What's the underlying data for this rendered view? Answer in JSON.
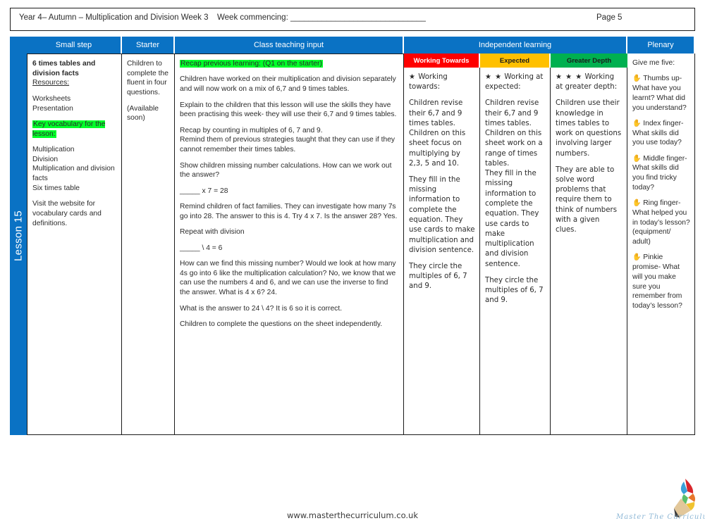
{
  "header": {
    "title": "Year 4– Autumn – Multiplication and Division Week 3",
    "week_commencing": "Week commencing: ______________________________",
    "page": "Page 5"
  },
  "lesson_tab": {
    "label": "Lesson 15"
  },
  "columns": {
    "small_step": "Small step",
    "starter": "Starter",
    "class_teaching_input": "Class teaching input",
    "independent_learning": "Independent learning",
    "plenary": "Plenary"
  },
  "bands": {
    "working_towards": "Working Towards",
    "expected": "Expected",
    "greater_depth": "Greater Depth"
  },
  "small_step": {
    "title": "6 times tables and division facts",
    "resources_label": "Resources:",
    "resource_1": "Worksheets",
    "resource_2": "Presentation",
    "key_vocab_label": "Key vocabulary for the lesson:",
    "vocab_1": "Multiplication",
    "vocab_2": "Division",
    "vocab_3": "Multiplication and division facts",
    "vocab_4": "Six times table",
    "website_note": "Visit the website for vocabulary cards and definitions."
  },
  "starter": {
    "line_1": "Children to complete the fluent in four questions.",
    "line_2": "(Available soon)"
  },
  "teaching_input": {
    "recap_heading": "Recap previous learning: (Q1 on the starter)",
    "p1": "Children have worked on their multiplication and division separately and will now work on a mix of 6,7 and 9 times tables.",
    "p2": "Explain to the children that this lesson will use the skills they have been practising this week- they will use their 6,7 and 9 times tables.",
    "p3": "Recap by counting in multiples of 6, 7 and 9.",
    "p4": "Remind them of previous strategies taught that they can use if they cannot remember their times tables.",
    "p5": "Show children missing number calculations. How can we work out the answer?",
    "equation_1": "_____ x 7 = 28",
    "p6": "Remind children of fact families. They can investigate how many 7s go into 28. The answer to this is 4. Try 4 x 7. Is the answer 28? Yes.",
    "p7": "Repeat with division",
    "equation_2": "_____ \\ 4 = 6",
    "p8": "How can we find this missing number? Would we look at how many 4s go into 6 like the multiplication calculation? No, we know that we can use the numbers 4 and 6, and we can use the inverse to find the answer. What is 4 x 6? 24.",
    "p9": "What is the answer to 24 \\ 4? It is 6 so it is correct.",
    "p10": "Children to complete the questions on the sheet independently."
  },
  "working_towards": {
    "stars": "★",
    "heading": "Working towards:",
    "p1": "Children revise their 6,7 and 9 times tables. Children on this sheet focus on multiplying by 2,3, 5 and 10.",
    "p2": "They fill in the missing information to complete the equation. They use cards to make multiplication and division sentence.",
    "p3": "They circle the multiples of 6, 7 and 9."
  },
  "expected": {
    "stars": "★ ★",
    "heading": "Working at expected:",
    "p1": "Children revise their 6,7 and 9 times tables. Children on this sheet work on a range of times tables.",
    "p2": "They fill in the missing information to complete the equation. They use cards to make multiplication and division sentence.",
    "p3": "They circle the multiples of 6, 7 and 9."
  },
  "greater_depth": {
    "stars": "★ ★ ★",
    "heading": "Working at greater depth:",
    "p1": "Children use their knowledge in times tables to work on questions involving larger numbers.",
    "p2": "They are able to solve word problems that require them to think of numbers with a given clues."
  },
  "plenary": {
    "heading": "Give me five:",
    "items": [
      {
        "icon": "✋",
        "text": "Thumbs up- What have you learnt? What did you understand?"
      },
      {
        "icon": "✋",
        "text": "Index finger- What skills did you use today?"
      },
      {
        "icon": "✋",
        "text": "Middle finger- What skills did you find tricky today?"
      },
      {
        "icon": "✋",
        "text": "Ring finger- What helped you in today’s lesson? (equipment/ adult)"
      },
      {
        "icon": "✋",
        "text": "Pinkie promise- What will you make sure you remember from today’s lesson?"
      }
    ]
  },
  "footer": {
    "url": "www.masterthecurriculum.co.uk",
    "logo_text": "Master The Curriculum"
  },
  "colors": {
    "brand_blue": "#0a72c4",
    "highlight_green": "#00ff2a",
    "working_towards": "#ff0000",
    "expected": "#ffc000",
    "greater_depth": "#00b050"
  }
}
